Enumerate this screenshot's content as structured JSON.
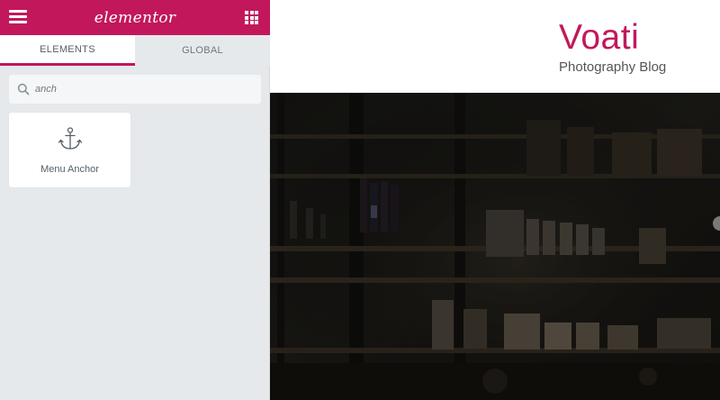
{
  "editor": {
    "logo_text": "elementor",
    "tabs": [
      {
        "label": "ELEMENTS",
        "active": true
      },
      {
        "label": "GLOBAL",
        "active": false
      }
    ],
    "search": {
      "value": "anch"
    },
    "widgets": [
      {
        "label": "Menu Anchor",
        "icon": "anchor-icon"
      }
    ]
  },
  "site": {
    "title": "Voati",
    "tagline": "Photography Blog"
  },
  "colors": {
    "accent": "#c2185b",
    "panel_bg": "#e6e9ec"
  }
}
